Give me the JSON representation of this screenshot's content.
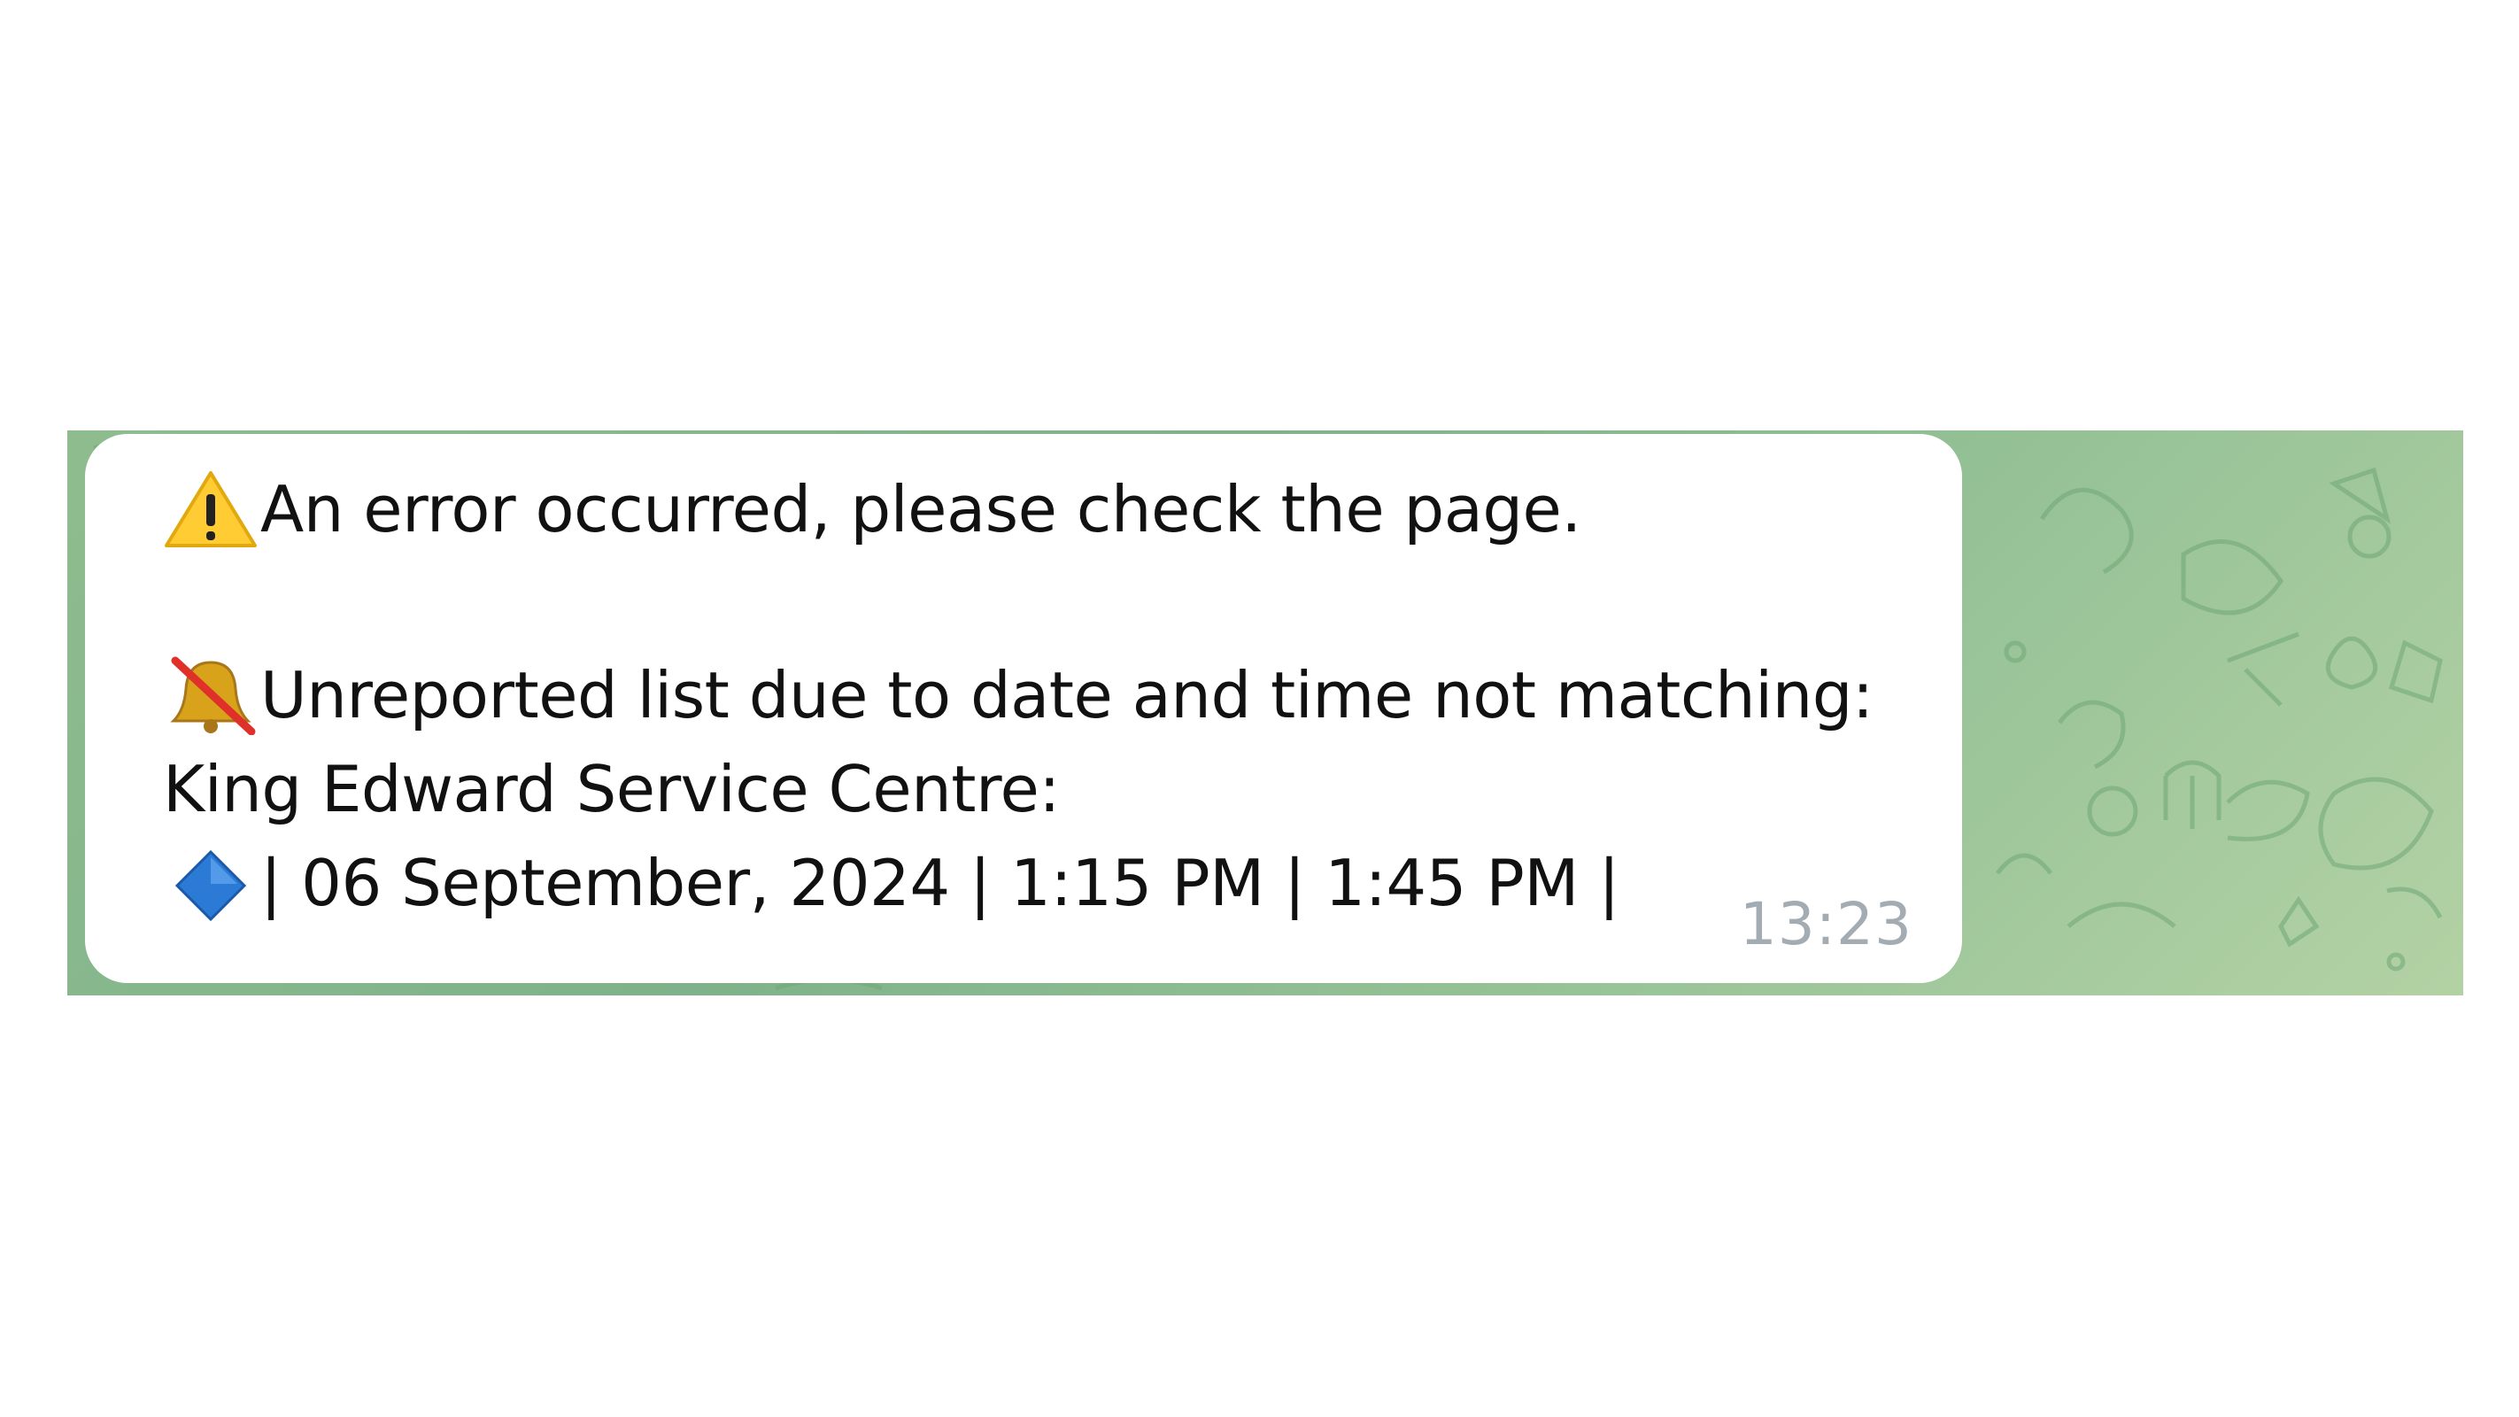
{
  "message": {
    "line1_icon": "warning-icon",
    "line1_text": "An error occurred, please check the page.",
    "line2_icon": "bell-muted-icon",
    "line2_text": "Unreported list due to date and time not matching:",
    "line3_text": "King Edward Service Centre:",
    "line4_icon": "blue-diamond-icon",
    "line4_text": "| 06 September, 2024 | 1:15 PM | 1:45 PM |",
    "time": "13:23"
  },
  "colors": {
    "wallpaper": "#8fbc8f",
    "bubble": "#ffffff",
    "text": "#111111",
    "timestamp": "#a4acb3",
    "warning": "#ffcc33",
    "diamond": "#2a7ad6",
    "bell": "#d9a21b",
    "strike": "#e0302a"
  }
}
